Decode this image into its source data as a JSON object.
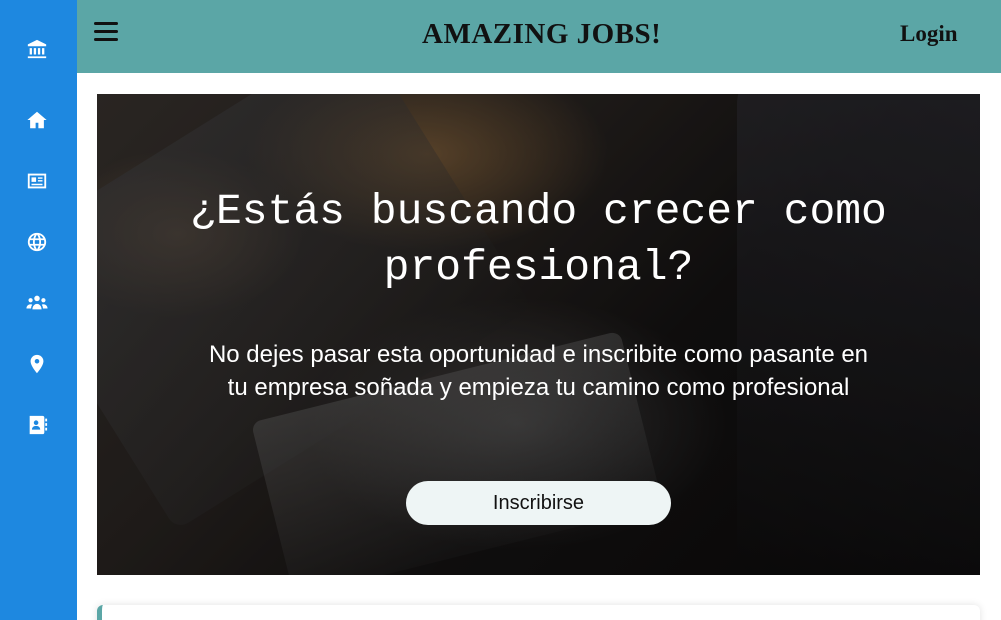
{
  "header": {
    "brand": "AMAZING JOBS!",
    "login_label": "Login"
  },
  "sidebar": {
    "icons": [
      "bank-icon",
      "home-icon",
      "id-card-icon",
      "globe-icon",
      "users-icon",
      "map-pin-icon",
      "address-book-icon"
    ]
  },
  "hero": {
    "title": "¿Estás buscando crecer como profesional?",
    "text": "No dejes pasar esta oportunidad e inscribite como pasante en tu empresa soñada y empieza tu camino como profesional",
    "cta_label": "Inscribirse"
  },
  "colors": {
    "sidebar": "#1e88e0",
    "topbar": "#5ba6a6",
    "cta_bg": "#eef5f5"
  }
}
